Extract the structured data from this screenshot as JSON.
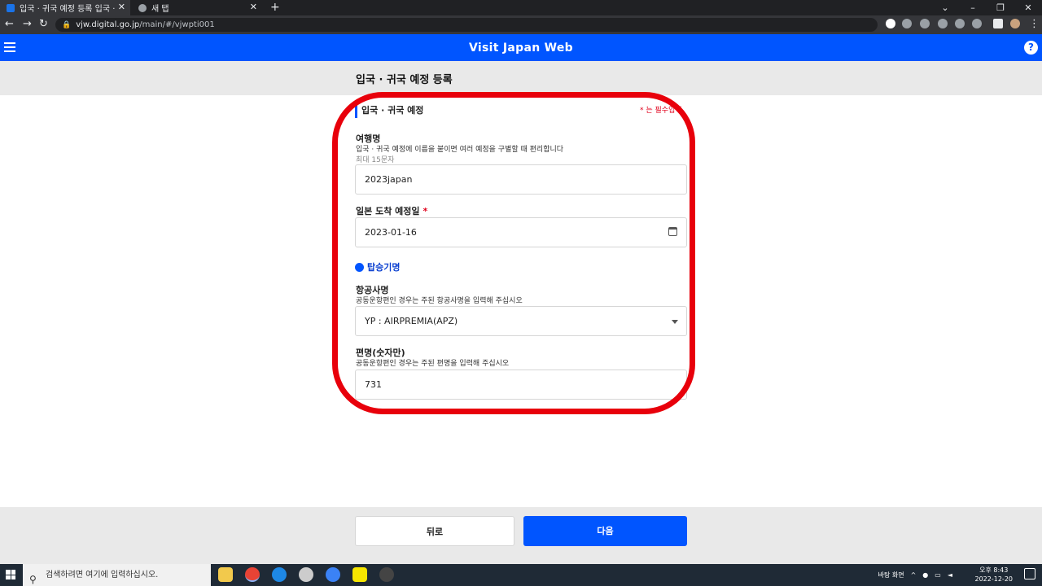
{
  "browser": {
    "tabs": [
      {
        "title": "입국 · 귀국 예정 등록 입국 · 귀국",
        "active": true
      },
      {
        "title": "새 탭",
        "active": false
      }
    ],
    "new_tab": "+",
    "close": "✕",
    "url_host": "vjw.digital.go.jp",
    "url_path": "/main/#/vjwpti001"
  },
  "app": {
    "title": "Visit Japan Web",
    "help": "?"
  },
  "page": {
    "title": "입국 · 귀국 예정 등록",
    "section_title": "입국 · 귀국 예정",
    "required_note": "* 는 필수입력"
  },
  "form": {
    "trip_name": {
      "label": "여행명",
      "hint": "입국 · 귀국 예정에 이름을 붙이면 여러 예정을 구별할 때 편리합니다",
      "max": "최대 15문자",
      "value": "2023japan"
    },
    "arrival_date": {
      "label": "일본 도착 예정일",
      "required_mark": "*",
      "value": "2023-01-16"
    },
    "flight_radio": {
      "label": "탑승기명"
    },
    "airline": {
      "label": "항공사명",
      "hint": "공동운항편인 경우는 주된 항공사명을 입력해 주십시오",
      "value": "YP : AIRPREMIA(APZ)"
    },
    "flight_number": {
      "label": "편명(숫자만)",
      "hint": "공동운항편인 경우는 주된 편명을 입력해 주십시오",
      "value": "731"
    }
  },
  "buttons": {
    "back": "뒤로",
    "next": "다음"
  },
  "taskbar": {
    "search_placeholder": "검색하려면 여기에 입력하십시오.",
    "desktop_label": "바탕 화면",
    "time": "오후 8:43",
    "date": "2022-12-20"
  },
  "colors": {
    "brand_blue": "#0055ff",
    "highlight_red": "#e8000b"
  }
}
